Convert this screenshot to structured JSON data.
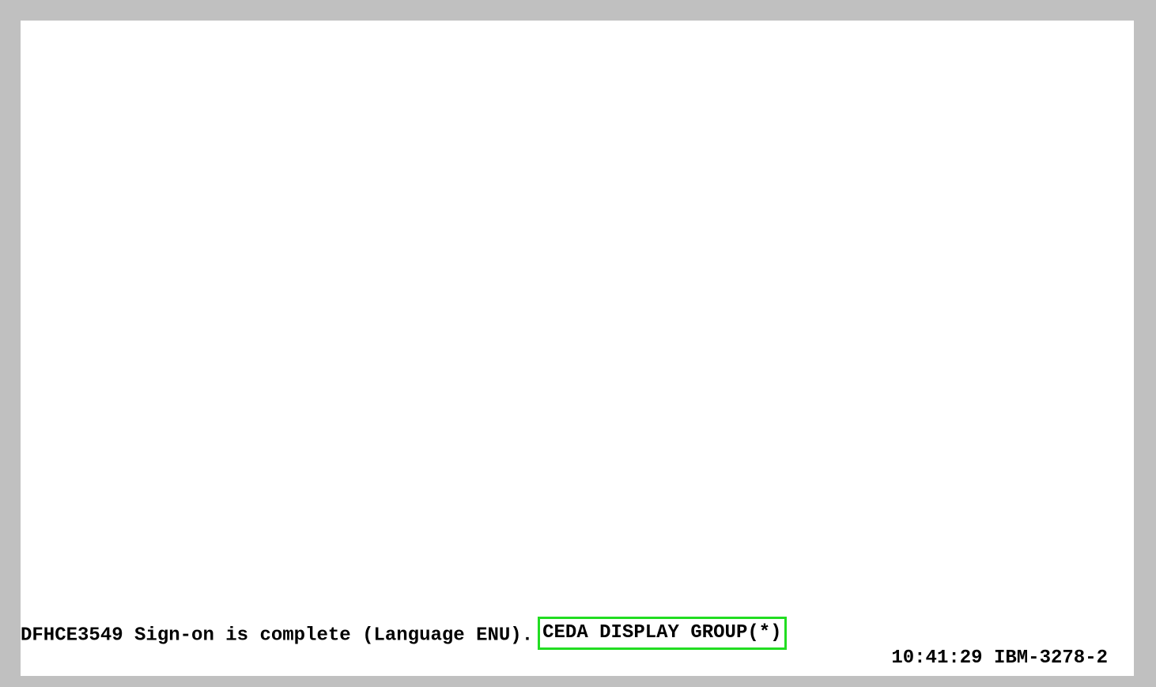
{
  "terminal": {
    "message": "DFHCE3549 Sign-on is complete (Language ENU).",
    "command": "CEDA DISPLAY GROUP(*)",
    "time": "10:41:29",
    "terminal_type": "IBM-3278-2"
  },
  "colors": {
    "frame": "#c0c0c0",
    "screen_background": "#ffffff",
    "text": "#000000",
    "highlight_border": "#22dd22"
  }
}
